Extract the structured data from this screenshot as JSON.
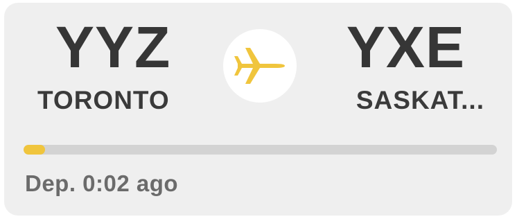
{
  "flight": {
    "origin_code": "YYZ",
    "origin_city": "TORONTO",
    "destination_code": "YXE",
    "destination_city": "SASKAT...",
    "departure_status": "Dep. 0:02 ago",
    "progress_fraction": 0.045
  },
  "icons": {
    "plane": "airplane-icon"
  },
  "colors": {
    "accent": "#f0c53d",
    "card_bg": "#efefef",
    "track": "#d3d3d3",
    "text_dark": "#363636",
    "text_muted": "#6b6b6b"
  }
}
